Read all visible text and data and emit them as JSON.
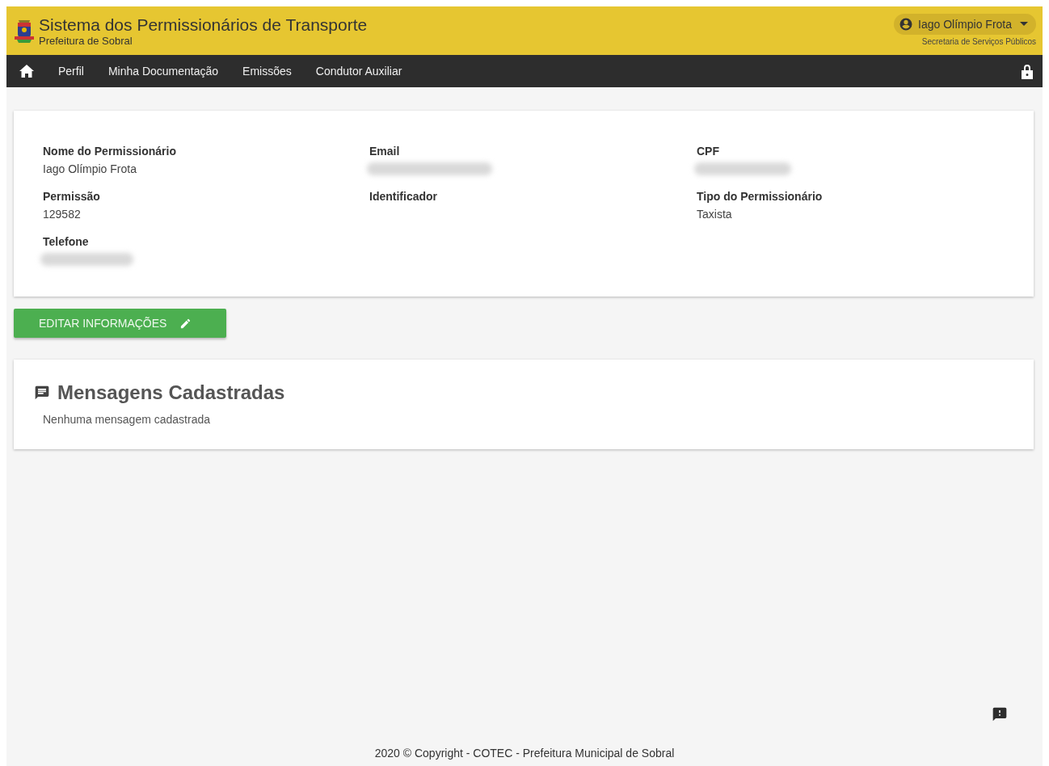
{
  "header": {
    "title": "Sistema dos Permissionários de Transporte",
    "subtitle": "Prefeitura de Sobral",
    "user": {
      "name": "Iago Olímpio Frota",
      "department": "Secretaria de Serviços Públicos"
    }
  },
  "nav": {
    "items": [
      {
        "label": "Perfil"
      },
      {
        "label": "Minha Documentação"
      },
      {
        "label": "Emissões"
      },
      {
        "label": "Condutor Auxiliar"
      }
    ]
  },
  "profile": {
    "fields": [
      {
        "label": "Nome do Permissionário",
        "value": "Iago Olímpio Frota",
        "redacted": false
      },
      {
        "label": "Email",
        "redacted": true
      },
      {
        "label": "CPF",
        "redacted": true
      },
      {
        "label": "Permissão",
        "value": "129582",
        "redacted": false
      },
      {
        "label": "Identificador",
        "redacted": false
      },
      {
        "label": "Tipo do Permissionário",
        "value": "Taxista",
        "redacted": false
      },
      {
        "label": "Telefone",
        "redacted": true
      }
    ]
  },
  "edit_button": {
    "label": "EDITAR INFORMAÇÕES"
  },
  "messages": {
    "title": "Mensagens Cadastradas",
    "empty_text": "Nenhuma mensagem cadastrada"
  },
  "footer": {
    "text": "2020 © Copyright - COTEC - Prefeitura Municipal de Sobral"
  }
}
